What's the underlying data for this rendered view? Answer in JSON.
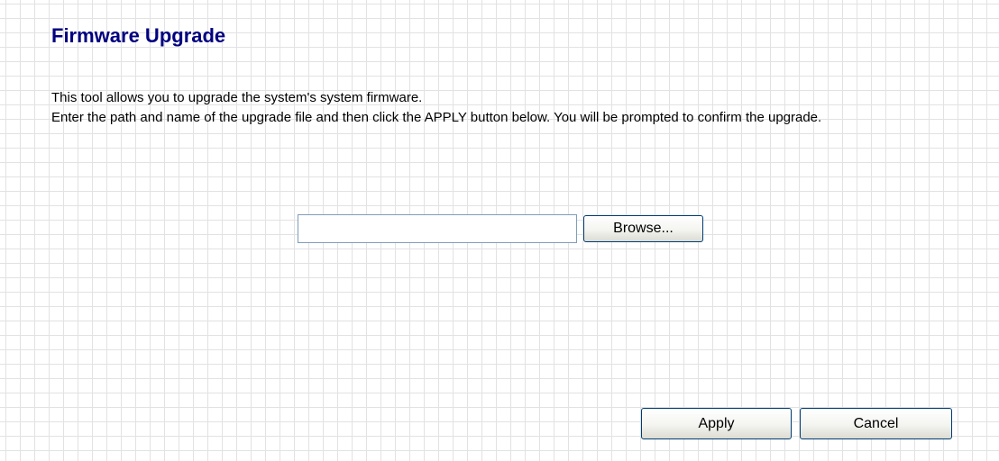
{
  "page": {
    "title": "Firmware Upgrade",
    "description_line1": "This tool allows you to upgrade the system's system firmware.",
    "description_line2": "Enter the path and name of the upgrade file and then click the APPLY button below. You will be prompted to confirm the upgrade."
  },
  "upload": {
    "file_path_value": "",
    "browse_label": "Browse..."
  },
  "actions": {
    "apply_label": "Apply",
    "cancel_label": "Cancel"
  },
  "colors": {
    "title": "#000080",
    "grid_line": "#e2e2e2",
    "button_border": "#003c74"
  }
}
